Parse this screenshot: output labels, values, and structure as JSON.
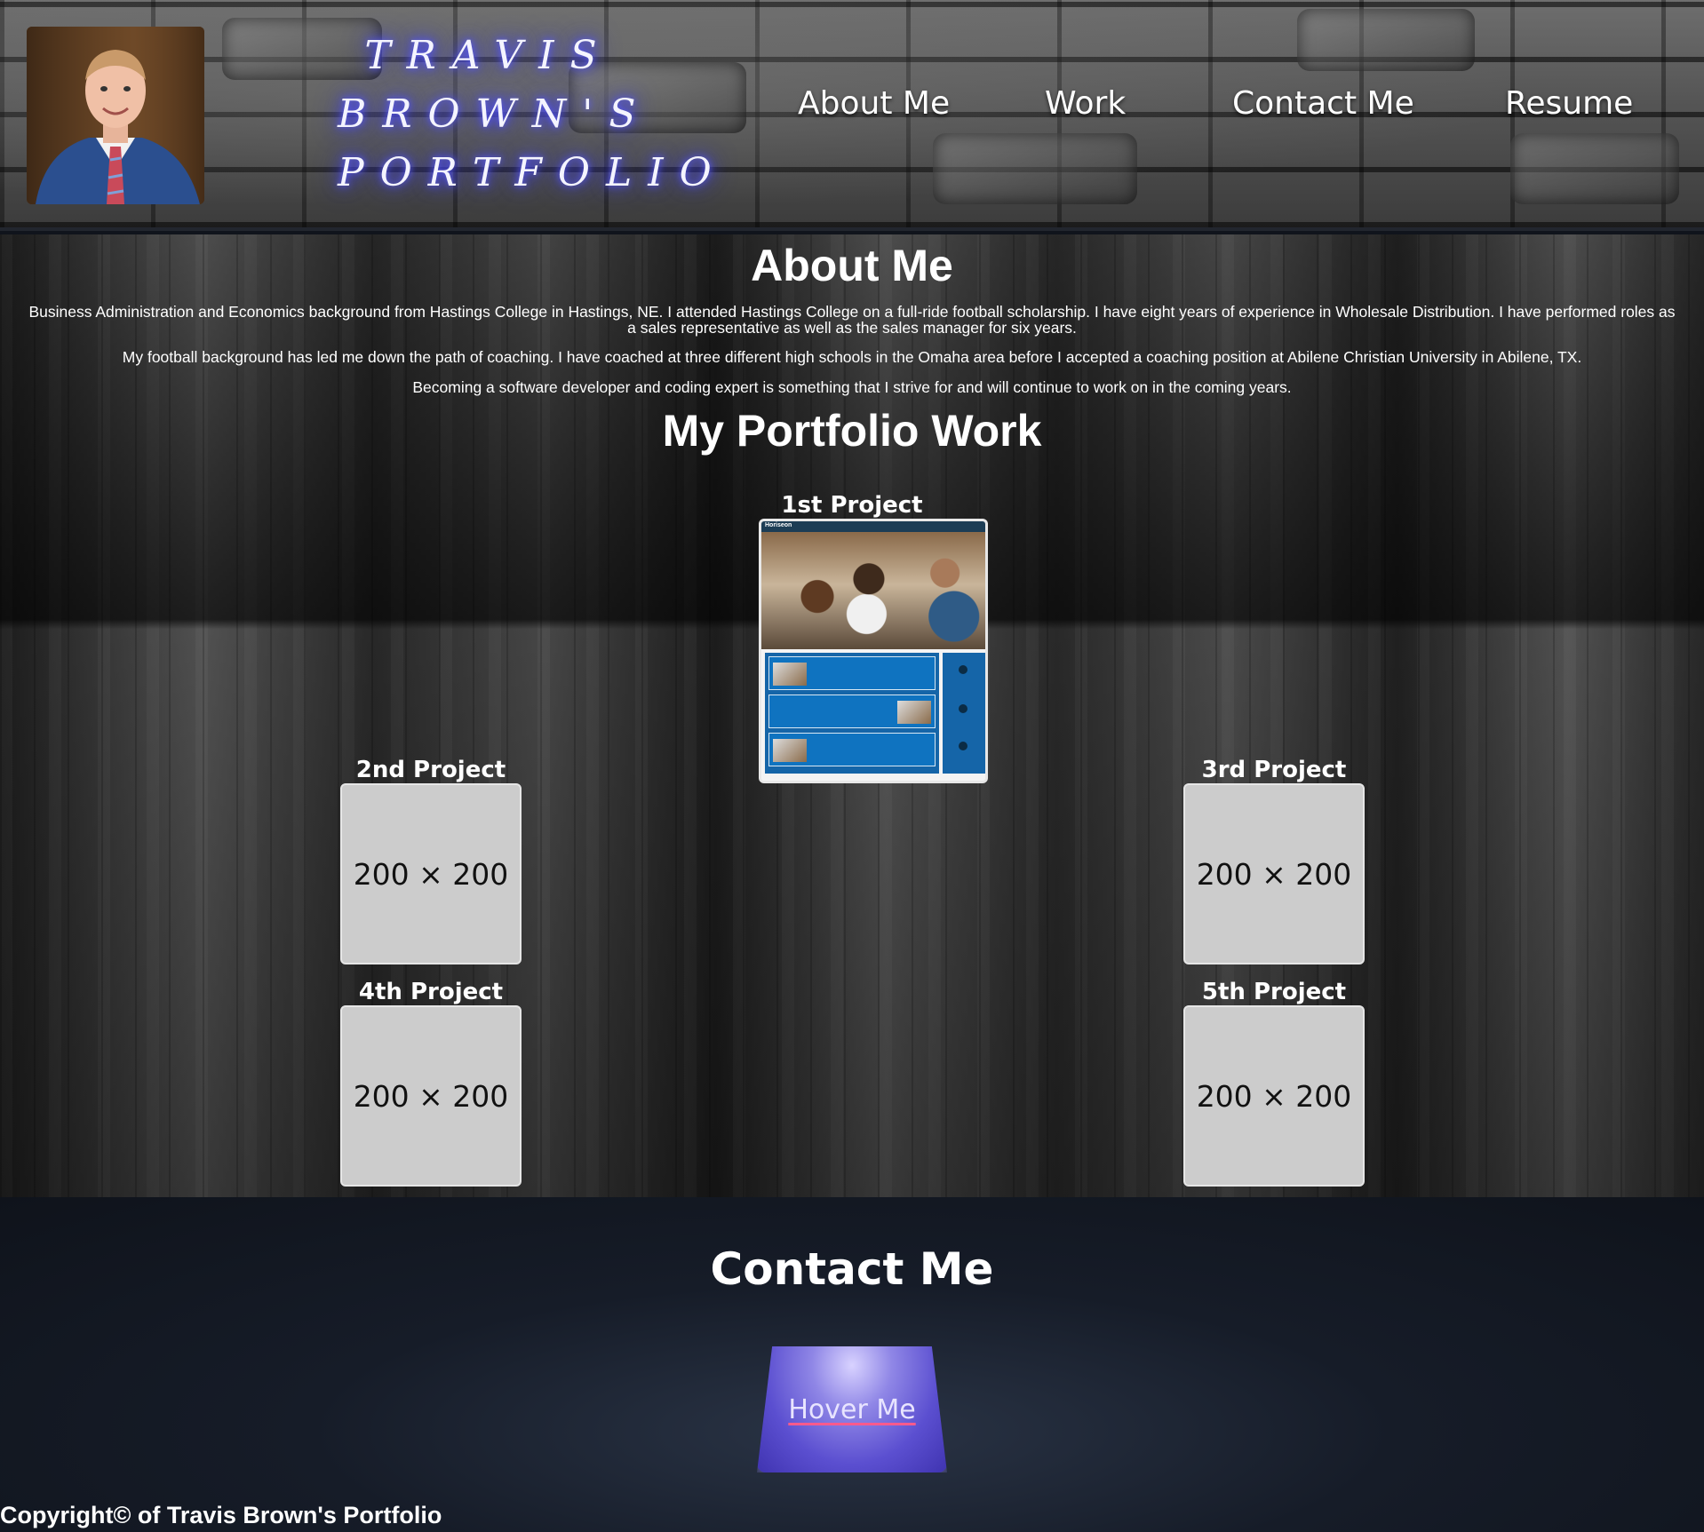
{
  "header": {
    "brand_lines": [
      "TRAVIS",
      "BROWN'S",
      "PORTFOLIO"
    ],
    "nav": {
      "about": "About Me",
      "work": "Work",
      "contact": "Contact Me",
      "resume": "Resume"
    }
  },
  "about": {
    "heading": "About Me",
    "paragraphs": [
      "Business Administration and Economics background from Hastings College in Hastings, NE. I attended Hastings College on a full-ride football scholarship. I have eight years of experience in Wholesale Distribution. I have performed roles as a sales representative as well as the sales manager for six years.",
      "My football background has led me down the path of coaching. I have coached at three different high schools in the Omaha area before I accepted a coaching position at Abilene Christian University in Abilene, TX.",
      "Becoming a software developer and coding expert is something that I strive for and will continue to work on in the coming years."
    ]
  },
  "portfolio": {
    "heading": "My Portfolio Work",
    "projects": [
      {
        "label": "1st Project",
        "thumb_title": "Horiseon"
      },
      {
        "label": "2nd Project",
        "placeholder": "200 × 200"
      },
      {
        "label": "3rd Project",
        "placeholder": "200 × 200"
      },
      {
        "label": "4th Project",
        "placeholder": "200 × 200"
      },
      {
        "label": "5th Project",
        "placeholder": "200 × 200"
      }
    ]
  },
  "contact": {
    "heading": "Contact Me",
    "button_label": "Hover Me"
  },
  "footer": {
    "copyright": "Copyright© of Travis Brown's Portfolio"
  },
  "colors": {
    "contact_bg": "#161c28",
    "button_accent": "#5b4fd0",
    "brand_glow": "#3b3bff",
    "placeholder_bg": "#cccccc"
  }
}
